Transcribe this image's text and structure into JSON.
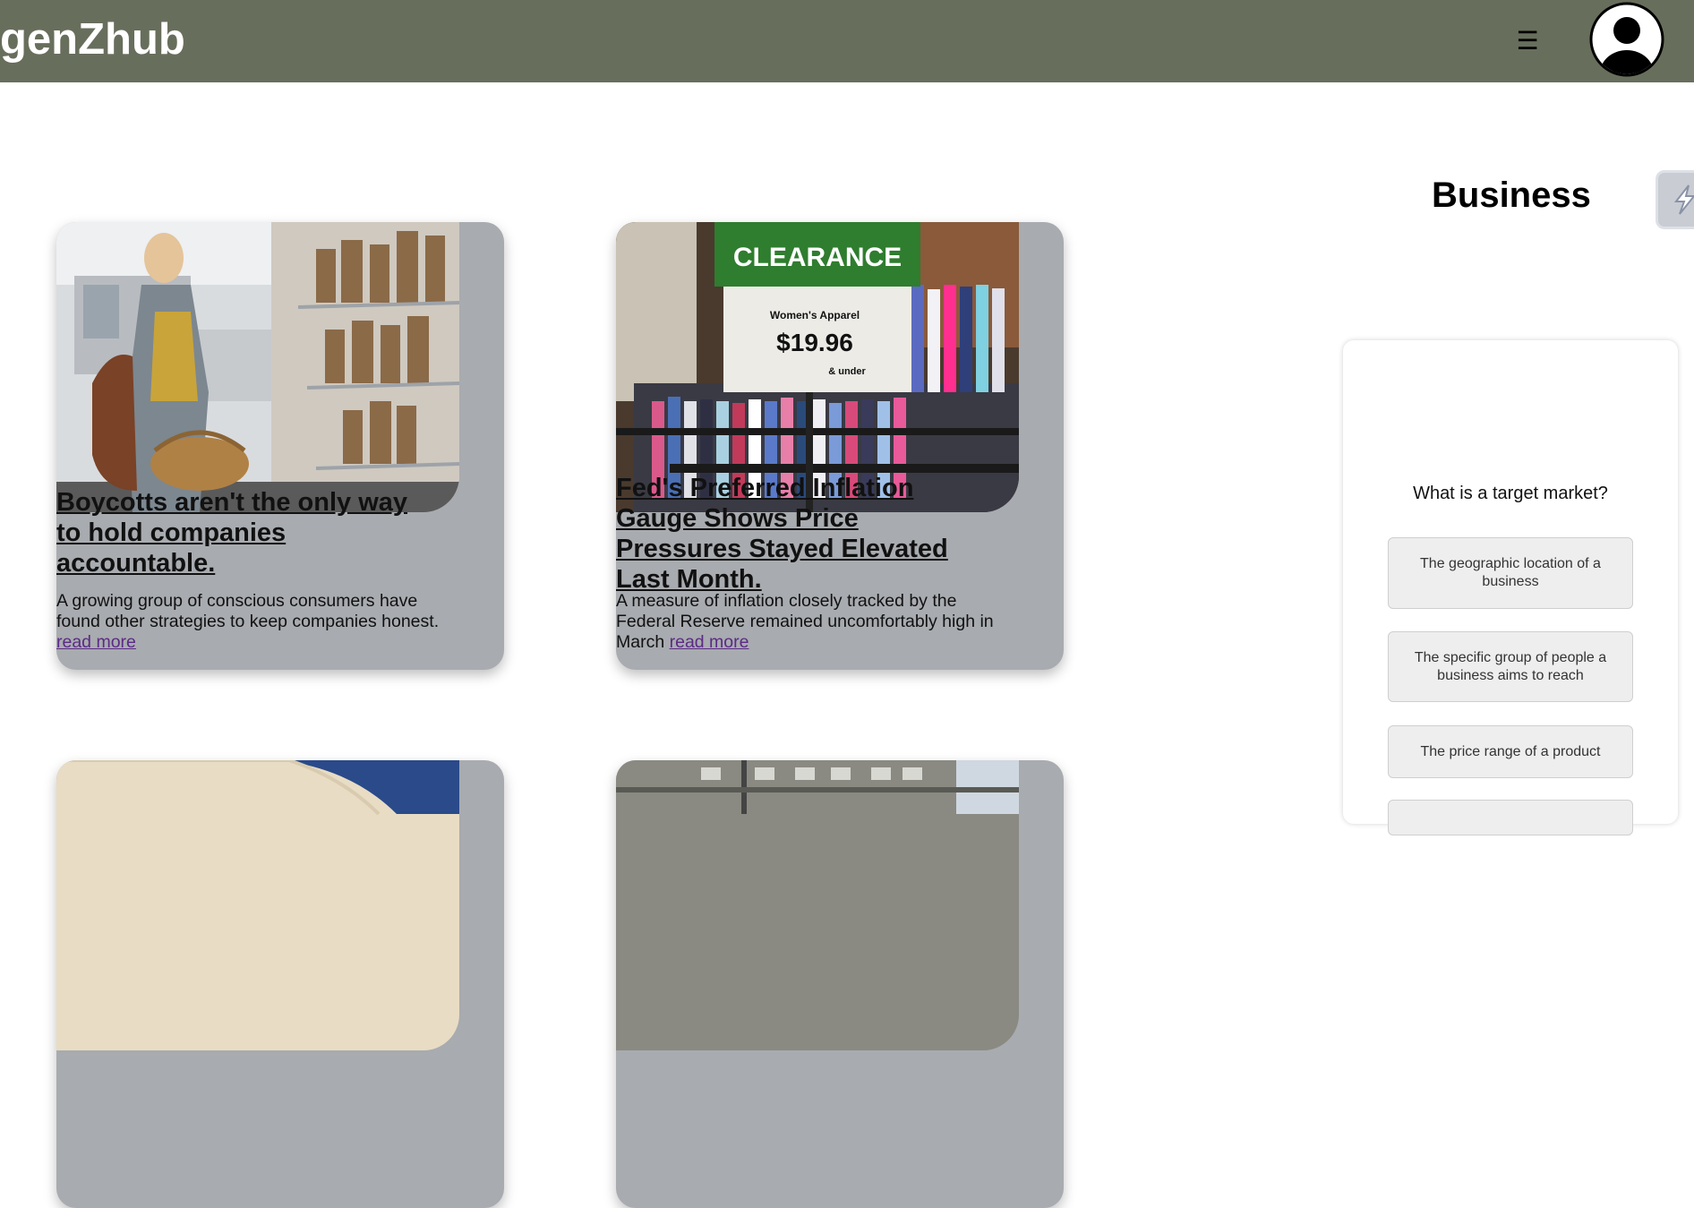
{
  "header": {
    "logo": "genZhub",
    "menu_icon": "☰",
    "avatar_icon": "user-avatar-icon"
  },
  "section": {
    "title": "Business"
  },
  "cards": [
    {
      "title": "Boycotts aren't the only way to hold companies accountable.",
      "description": "A growing group of conscious consumers have found other strategies to keep companies honest.",
      "link": "read more",
      "image": "woman-shopping-basket-photo"
    },
    {
      "title": "Fed's Preferred Inflation Gauge Shows Price Pressures Stayed Elevated Last Month.",
      "description": "A measure of inflation closely tracked by the Federal Reserve remained uncomfortably high in March",
      "link": "read more",
      "image": "clearance-sign-photo",
      "sign": {
        "banner": "CLEARANCE",
        "line1": "Women's Apparel",
        "price": "$19.96",
        "line3": "& under"
      }
    },
    {
      "image": "business-photo-partial"
    },
    {
      "image": "building-photo-partial"
    }
  ],
  "quiz": {
    "question": "What is a target market?",
    "options": [
      "The geographic location of a business",
      "The specific group of people a business aims to reach",
      "The price range of a product"
    ]
  },
  "colors": {
    "header_bg": "#686e5c",
    "card_bg": "#a8abaf",
    "link": "#5b2a86"
  }
}
